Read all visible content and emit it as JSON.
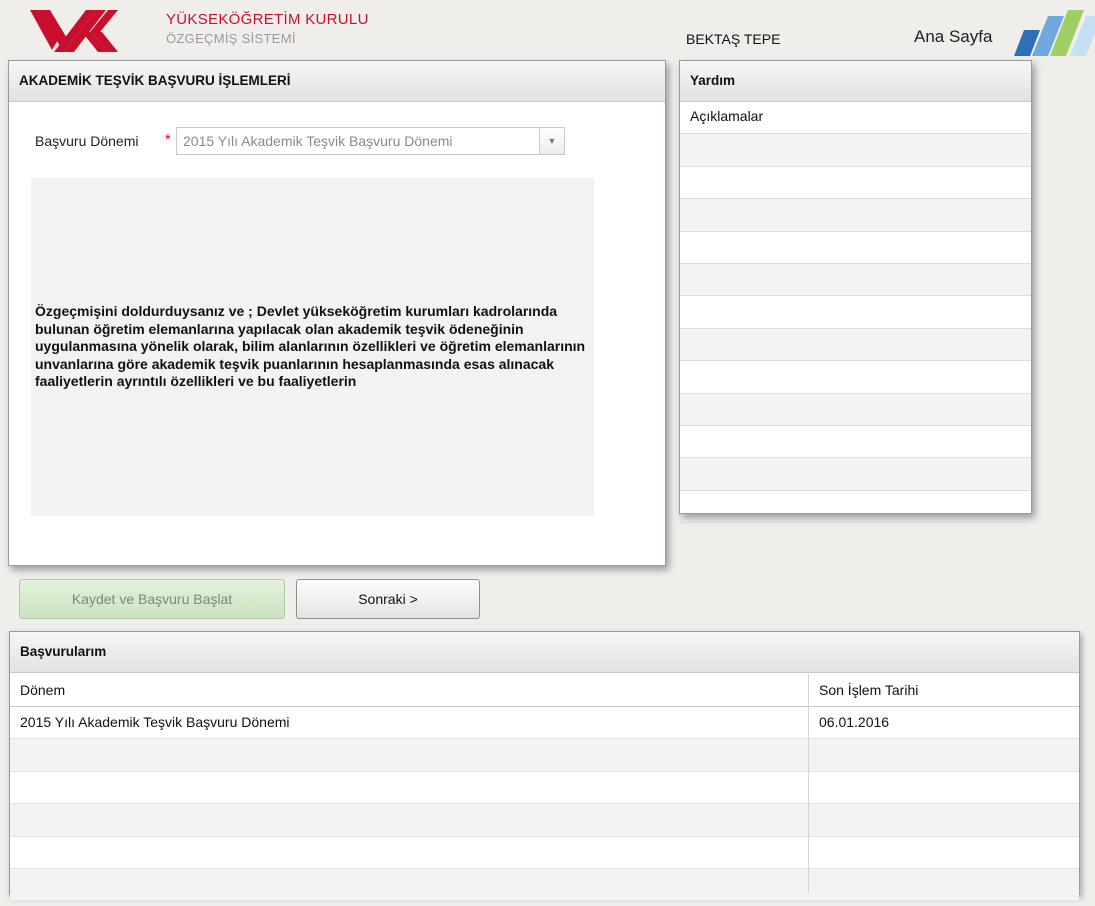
{
  "header": {
    "brand_title": "YÜKSEKÖĞRETİM KURULU",
    "brand_subtitle": "ÖZGEÇMİŞ SİSTEMİ",
    "user_name": "BEKTAŞ TEPE",
    "home_link": "Ana Sayfa",
    "brand_color": "#c8102e",
    "stripe_colors": [
      "#2f6fb5",
      "#6fa8dc",
      "#9fce63",
      "#c5e0f3"
    ]
  },
  "application": {
    "title": "AKADEMİK TEŞVİK BAŞVURU İŞLEMLERİ",
    "period_label": "Başvuru Dönemi",
    "required_mark": "*",
    "period_selected": "2015 Yılı Akademik Teşvik Başvuru Dönemi",
    "info_text": "Özgeçmişini doldurduysanız ve ; Devlet yükseköğretim kurumları kadrolarında bulunan öğretim elemanlarına yapılacak olan akademik teşvik ödeneğinin uygulanmasına yönelik olarak, bilim alanlarının özellikleri ve öğretim elemanlarının unvanlarına göre akademik teşvik puanlarının hesaplanmasında esas alınacak faaliyetlerin ayrıntılı özellikleri ve bu faaliyetlerin"
  },
  "help": {
    "title": "Yardım",
    "rows": [
      "Açıklamalar",
      "",
      "",
      "",
      "",
      "",
      "",
      "",
      "",
      "",
      "",
      "",
      ""
    ]
  },
  "actions": {
    "save_label": "Kaydet ve Başvuru Başlat",
    "next_label": "Sonraki >"
  },
  "applications": {
    "title": "Başvurularım",
    "columns": [
      "Dönem",
      "Son İşlem Tarihi"
    ],
    "rows": [
      {
        "period": "2015 Yılı Akademik Teşvik Başvuru Dönemi",
        "date": "06.01.2016"
      },
      {
        "period": "",
        "date": ""
      },
      {
        "period": "",
        "date": ""
      },
      {
        "period": "",
        "date": ""
      },
      {
        "period": "",
        "date": ""
      },
      {
        "period": "",
        "date": ""
      }
    ]
  }
}
